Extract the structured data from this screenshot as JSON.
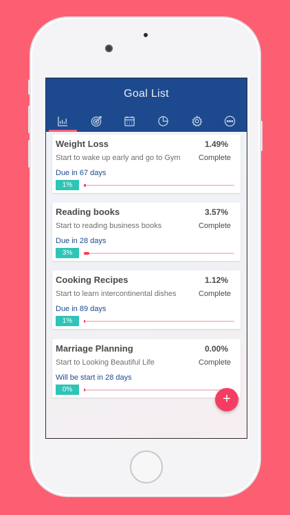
{
  "header": {
    "title": "Goal List"
  },
  "tabs": [
    {
      "icon": "chart-icon",
      "active": true
    },
    {
      "icon": "target-icon",
      "active": false
    },
    {
      "icon": "calendar-icon",
      "active": false
    },
    {
      "icon": "pie-chart-icon",
      "active": false
    },
    {
      "icon": "gear-icon",
      "active": false
    },
    {
      "icon": "more-icon",
      "active": false
    }
  ],
  "goals": [
    {
      "title": "Weight Loss",
      "percent": "1.49%",
      "description": "Start to wake up early and go to Gym",
      "status": "Complete",
      "due": "Due in 67 days",
      "badge": "1%",
      "progress": 0.0149
    },
    {
      "title": "Reading books",
      "percent": "3.57%",
      "description": "Start to reading business books",
      "status": "Complete",
      "due": "Due in 28 days",
      "badge": "3%",
      "progress": 0.0357
    },
    {
      "title": "Cooking Recipes",
      "percent": "1.12%",
      "description": "Start to learn intercontinental dishes",
      "status": "Complete",
      "due": "Due in 89 days",
      "badge": "1%",
      "progress": 0.0112
    },
    {
      "title": "Marriage Planning",
      "percent": "0.00%",
      "description": "Start to Looking Beautiful Life",
      "status": "Complete",
      "due": "Will be start in 28 days",
      "badge": "0%",
      "progress": 0.0
    }
  ],
  "fab": {
    "label": "+"
  },
  "colors": {
    "background": "#fd5f72",
    "header": "#1d4a8e",
    "badge": "#2ec4b6",
    "progress": "#ff3b4e",
    "fab": "#f53d63"
  }
}
